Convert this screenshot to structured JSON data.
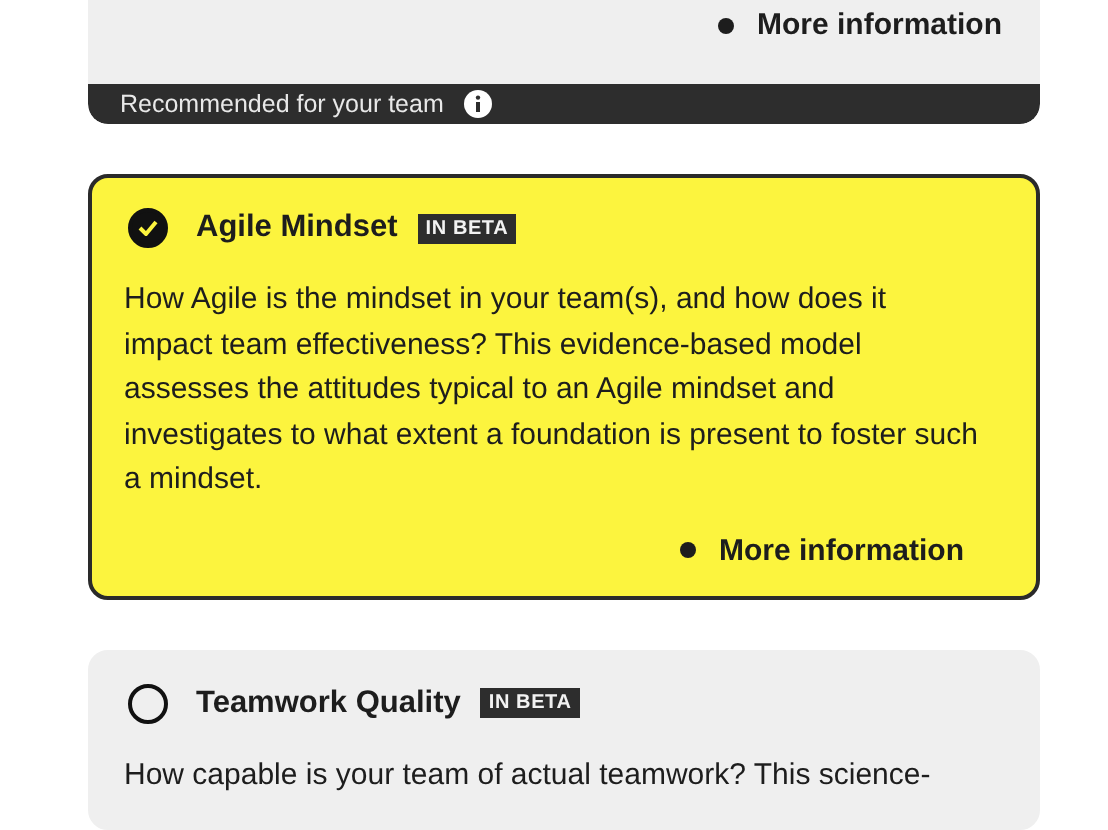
{
  "previous_card": {
    "more_info": "More information",
    "footer": {
      "text": "Recommended for your team"
    }
  },
  "models": [
    {
      "title": "Agile Mindset",
      "badge": "IN BETA",
      "selected": true,
      "description": "How Agile is the mindset in your team(s), and how does it impact team effectiveness? This evidence-based model assesses the attitudes typical to an Agile mindset and investigates to what extent a foundation is present to foster such a mindset.",
      "more_info": "More information"
    },
    {
      "title": "Teamwork Quality",
      "badge": "IN BETA",
      "selected": false,
      "description": "How capable is your team of actual teamwork? This science-"
    }
  ]
}
